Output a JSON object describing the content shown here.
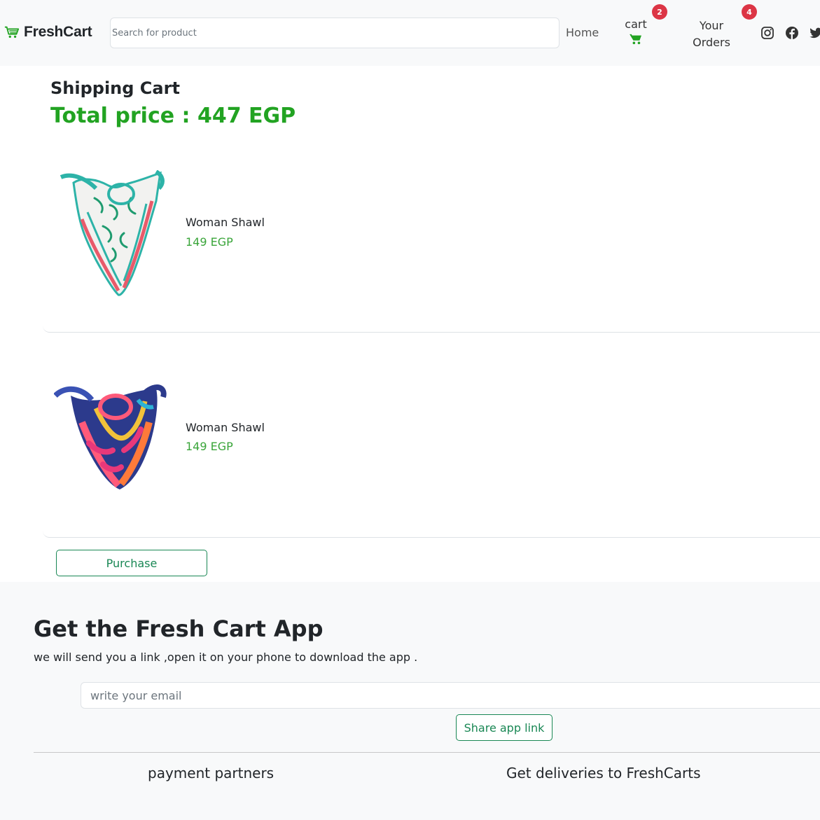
{
  "header": {
    "brand": "FreshCart",
    "search_placeholder": "Search for product",
    "nav": {
      "home": "Home",
      "cart": "cart",
      "cart_count": "2",
      "orders_line1": "Your",
      "orders_line2": "Orders",
      "orders_count": "4"
    },
    "social_icons": [
      "instagram-icon",
      "facebook-icon",
      "twitter-icon"
    ]
  },
  "cart": {
    "title": "Shipping Cart",
    "total": "Total price : 447 EGP",
    "items": [
      {
        "name": "Woman Shawl",
        "price": "149 EGP"
      },
      {
        "name": "Woman Shawl",
        "price": "149 EGP"
      }
    ],
    "purchase_label": "Purchase"
  },
  "footer": {
    "title": "Get the Fresh Cart App",
    "subtitle": "we will send you a link ,open it on your phone to download the app .",
    "email_placeholder": "write your email",
    "share_label": "Share app link",
    "payment_partners": "payment partners",
    "deliveries": "Get deliveries to FreshCarts"
  },
  "colors": {
    "brand_green": "#22a322",
    "badge_red": "#dc3545",
    "button_green": "#198754"
  }
}
